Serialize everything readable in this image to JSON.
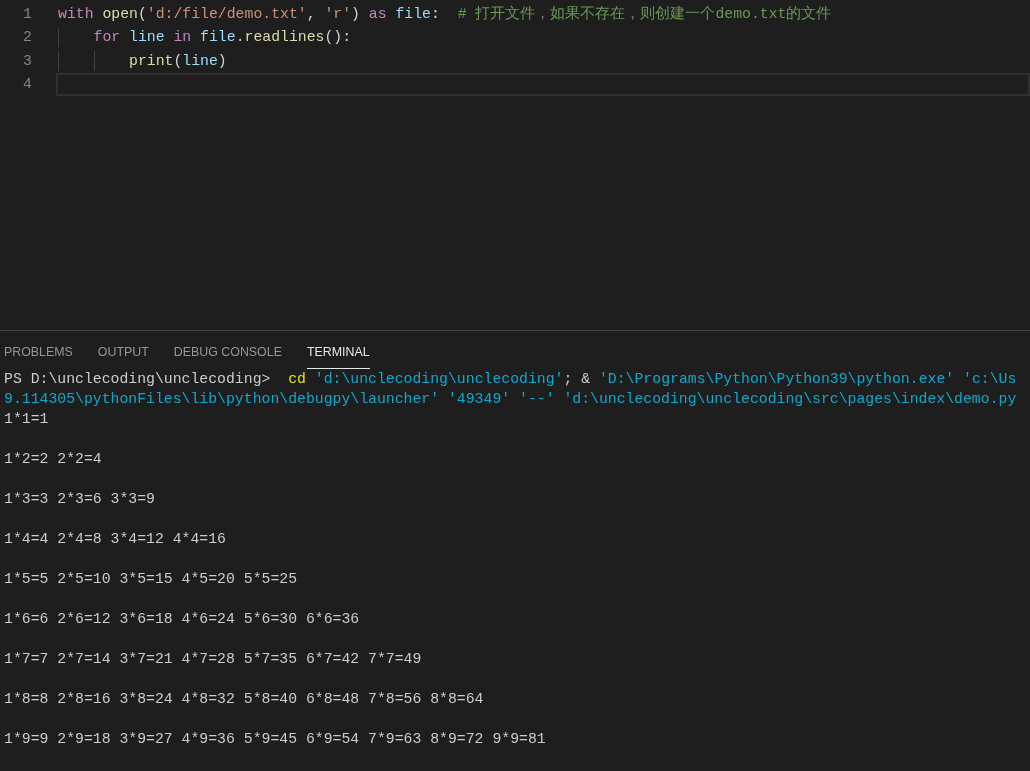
{
  "editor": {
    "lines": [
      {
        "number": "1",
        "active": false,
        "tokens": [
          {
            "text": "with ",
            "kind": "keyword"
          },
          {
            "text": "open",
            "kind": "function"
          },
          {
            "text": "(",
            "kind": "plain"
          },
          {
            "text": "'d:/file/demo.txt'",
            "kind": "string"
          },
          {
            "text": ", ",
            "kind": "plain"
          },
          {
            "text": "'r'",
            "kind": "string"
          },
          {
            "text": ") ",
            "kind": "plain"
          },
          {
            "text": "as ",
            "kind": "keyword"
          },
          {
            "text": "file",
            "kind": "variable"
          },
          {
            "text": ":  ",
            "kind": "plain"
          },
          {
            "text": "# 打开文件，如果不存在，则创建一个demo.txt的文件",
            "kind": "comment"
          }
        ]
      },
      {
        "number": "2",
        "active": false,
        "tokens": [
          {
            "text": "    for ",
            "kind": "keyword"
          },
          {
            "text": "line ",
            "kind": "variable"
          },
          {
            "text": "in ",
            "kind": "keyword"
          },
          {
            "text": "file",
            "kind": "variable"
          },
          {
            "text": ".",
            "kind": "plain"
          },
          {
            "text": "readlines",
            "kind": "function"
          },
          {
            "text": "():",
            "kind": "plain"
          }
        ]
      },
      {
        "number": "3",
        "active": false,
        "tokens": [
          {
            "text": "        print",
            "kind": "function"
          },
          {
            "text": "(",
            "kind": "plain"
          },
          {
            "text": "line",
            "kind": "variable"
          },
          {
            "text": ")",
            "kind": "plain"
          }
        ]
      },
      {
        "number": "4",
        "active": true
      }
    ]
  },
  "panel": {
    "tabs": [
      {
        "label": "PROBLEMS",
        "selected": false
      },
      {
        "label": "OUTPUT",
        "selected": false
      },
      {
        "label": "DEBUG CONSOLE",
        "selected": false
      },
      {
        "label": "TERMINAL",
        "selected": true
      }
    ],
    "command_lines": [
      [
        {
          "text": "PS D:\\unclecoding\\unclecoding>  ",
          "kind": "prompt"
        },
        {
          "text": "cd",
          "kind": "command"
        },
        {
          "text": " 'd:\\unclecoding\\unclecoding'",
          "kind": "argument"
        },
        {
          "text": "; & ",
          "kind": "prompt"
        },
        {
          "text": "'D:\\Programs\\Python\\Python39\\python.exe' 'c:\\Us",
          "kind": "argument"
        }
      ],
      [
        {
          "text": "9.114305\\pythonFiles\\lib\\python\\debugpy\\launcher' '49349' '--' 'd:\\unclecoding\\unclecoding\\src\\pages\\index\\demo.py",
          "kind": "argument"
        }
      ]
    ],
    "output_lines": [
      "1*1=1",
      "1*2=2 2*2=4",
      "1*3=3 2*3=6 3*3=9",
      "1*4=4 2*4=8 3*4=12 4*4=16",
      "1*5=5 2*5=10 3*5=15 4*5=20 5*5=25",
      "1*6=6 2*6=12 3*6=18 4*6=24 5*6=30 6*6=36",
      "1*7=7 2*7=14 3*7=21 4*7=28 5*7=35 6*7=42 7*7=49",
      "1*8=8 2*8=16 3*8=24 4*8=32 5*8=40 6*8=48 7*8=56 8*8=64",
      "1*9=9 2*9=18 3*9=27 4*9=36 5*9=45 6*9=54 7*9=63 8*9=72 9*9=81"
    ]
  }
}
